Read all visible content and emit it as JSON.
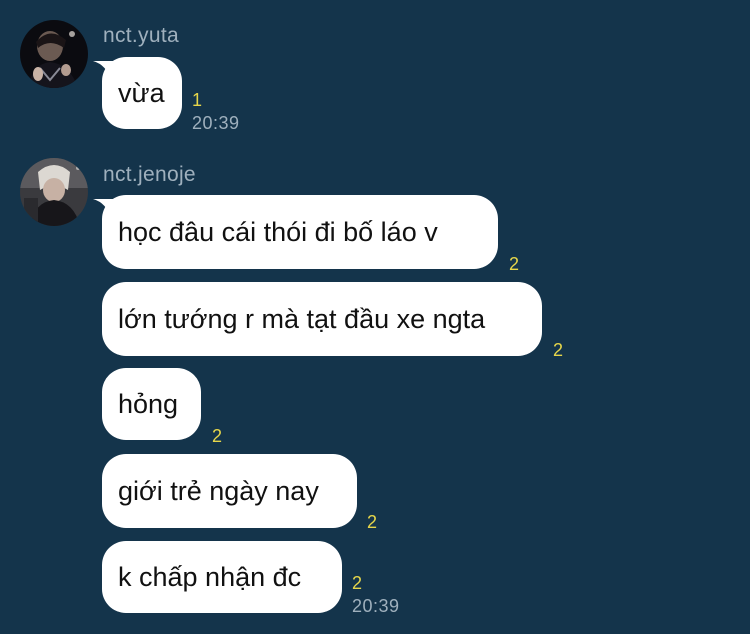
{
  "colors": {
    "background": "#14344b",
    "bubble": "#ffffff",
    "read_count": "#e6d64a",
    "meta_text": "#9fb0bd"
  },
  "groups": [
    {
      "sender": "nct.yuta",
      "avatar_icon": "profile-photo-avatar",
      "messages": [
        {
          "text": "vừa",
          "read": "1",
          "time": "20:39"
        }
      ]
    },
    {
      "sender": "nct.jenoje",
      "avatar_icon": "profile-photo-avatar",
      "messages": [
        {
          "text": "học đâu cái thói đi bố láo v",
          "read": "2"
        },
        {
          "text": "lớn tướng r mà tạt đầu xe ngta",
          "read": "2"
        },
        {
          "text": "hỏng",
          "read": "2"
        },
        {
          "text": "giới trẻ ngày nay",
          "read": "2"
        },
        {
          "text": "k chấp nhận đc",
          "read": "2",
          "time": "20:39"
        }
      ]
    }
  ]
}
